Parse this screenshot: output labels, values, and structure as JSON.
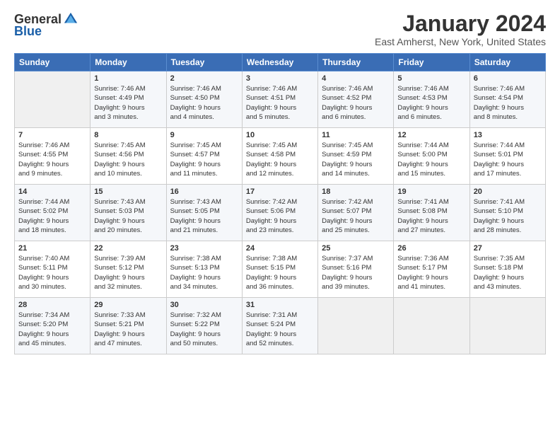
{
  "header": {
    "logo_general": "General",
    "logo_blue": "Blue",
    "title": "January 2024",
    "subtitle": "East Amherst, New York, United States"
  },
  "days_of_week": [
    "Sunday",
    "Monday",
    "Tuesday",
    "Wednesday",
    "Thursday",
    "Friday",
    "Saturday"
  ],
  "weeks": [
    [
      {
        "day": "",
        "info": ""
      },
      {
        "day": "1",
        "info": "Sunrise: 7:46 AM\nSunset: 4:49 PM\nDaylight: 9 hours\nand 3 minutes."
      },
      {
        "day": "2",
        "info": "Sunrise: 7:46 AM\nSunset: 4:50 PM\nDaylight: 9 hours\nand 4 minutes."
      },
      {
        "day": "3",
        "info": "Sunrise: 7:46 AM\nSunset: 4:51 PM\nDaylight: 9 hours\nand 5 minutes."
      },
      {
        "day": "4",
        "info": "Sunrise: 7:46 AM\nSunset: 4:52 PM\nDaylight: 9 hours\nand 6 minutes."
      },
      {
        "day": "5",
        "info": "Sunrise: 7:46 AM\nSunset: 4:53 PM\nDaylight: 9 hours\nand 6 minutes."
      },
      {
        "day": "6",
        "info": "Sunrise: 7:46 AM\nSunset: 4:54 PM\nDaylight: 9 hours\nand 8 minutes."
      }
    ],
    [
      {
        "day": "7",
        "info": "Sunrise: 7:46 AM\nSunset: 4:55 PM\nDaylight: 9 hours\nand 9 minutes."
      },
      {
        "day": "8",
        "info": "Sunrise: 7:45 AM\nSunset: 4:56 PM\nDaylight: 9 hours\nand 10 minutes."
      },
      {
        "day": "9",
        "info": "Sunrise: 7:45 AM\nSunset: 4:57 PM\nDaylight: 9 hours\nand 11 minutes."
      },
      {
        "day": "10",
        "info": "Sunrise: 7:45 AM\nSunset: 4:58 PM\nDaylight: 9 hours\nand 12 minutes."
      },
      {
        "day": "11",
        "info": "Sunrise: 7:45 AM\nSunset: 4:59 PM\nDaylight: 9 hours\nand 14 minutes."
      },
      {
        "day": "12",
        "info": "Sunrise: 7:44 AM\nSunset: 5:00 PM\nDaylight: 9 hours\nand 15 minutes."
      },
      {
        "day": "13",
        "info": "Sunrise: 7:44 AM\nSunset: 5:01 PM\nDaylight: 9 hours\nand 17 minutes."
      }
    ],
    [
      {
        "day": "14",
        "info": "Sunrise: 7:44 AM\nSunset: 5:02 PM\nDaylight: 9 hours\nand 18 minutes."
      },
      {
        "day": "15",
        "info": "Sunrise: 7:43 AM\nSunset: 5:03 PM\nDaylight: 9 hours\nand 20 minutes."
      },
      {
        "day": "16",
        "info": "Sunrise: 7:43 AM\nSunset: 5:05 PM\nDaylight: 9 hours\nand 21 minutes."
      },
      {
        "day": "17",
        "info": "Sunrise: 7:42 AM\nSunset: 5:06 PM\nDaylight: 9 hours\nand 23 minutes."
      },
      {
        "day": "18",
        "info": "Sunrise: 7:42 AM\nSunset: 5:07 PM\nDaylight: 9 hours\nand 25 minutes."
      },
      {
        "day": "19",
        "info": "Sunrise: 7:41 AM\nSunset: 5:08 PM\nDaylight: 9 hours\nand 27 minutes."
      },
      {
        "day": "20",
        "info": "Sunrise: 7:41 AM\nSunset: 5:10 PM\nDaylight: 9 hours\nand 28 minutes."
      }
    ],
    [
      {
        "day": "21",
        "info": "Sunrise: 7:40 AM\nSunset: 5:11 PM\nDaylight: 9 hours\nand 30 minutes."
      },
      {
        "day": "22",
        "info": "Sunrise: 7:39 AM\nSunset: 5:12 PM\nDaylight: 9 hours\nand 32 minutes."
      },
      {
        "day": "23",
        "info": "Sunrise: 7:38 AM\nSunset: 5:13 PM\nDaylight: 9 hours\nand 34 minutes."
      },
      {
        "day": "24",
        "info": "Sunrise: 7:38 AM\nSunset: 5:15 PM\nDaylight: 9 hours\nand 36 minutes."
      },
      {
        "day": "25",
        "info": "Sunrise: 7:37 AM\nSunset: 5:16 PM\nDaylight: 9 hours\nand 39 minutes."
      },
      {
        "day": "26",
        "info": "Sunrise: 7:36 AM\nSunset: 5:17 PM\nDaylight: 9 hours\nand 41 minutes."
      },
      {
        "day": "27",
        "info": "Sunrise: 7:35 AM\nSunset: 5:18 PM\nDaylight: 9 hours\nand 43 minutes."
      }
    ],
    [
      {
        "day": "28",
        "info": "Sunrise: 7:34 AM\nSunset: 5:20 PM\nDaylight: 9 hours\nand 45 minutes."
      },
      {
        "day": "29",
        "info": "Sunrise: 7:33 AM\nSunset: 5:21 PM\nDaylight: 9 hours\nand 47 minutes."
      },
      {
        "day": "30",
        "info": "Sunrise: 7:32 AM\nSunset: 5:22 PM\nDaylight: 9 hours\nand 50 minutes."
      },
      {
        "day": "31",
        "info": "Sunrise: 7:31 AM\nSunset: 5:24 PM\nDaylight: 9 hours\nand 52 minutes."
      },
      {
        "day": "",
        "info": ""
      },
      {
        "day": "",
        "info": ""
      },
      {
        "day": "",
        "info": ""
      }
    ]
  ]
}
